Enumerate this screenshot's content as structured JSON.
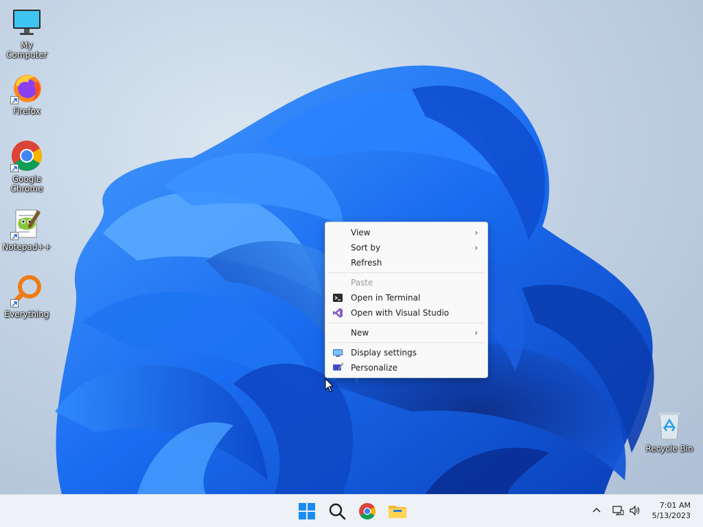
{
  "desktop_icons": [
    {
      "label": "My Computer",
      "icon": "monitor-icon"
    },
    {
      "label": "Firefox",
      "icon": "firefox-icon"
    },
    {
      "label": "Google Chrome",
      "icon": "chrome-icon"
    },
    {
      "label": "Notepad++",
      "icon": "notepad-plus-plus-icon"
    },
    {
      "label": "Everything",
      "icon": "everything-search-icon"
    },
    {
      "label": "Recycle Bin",
      "icon": "recycle-bin-icon"
    }
  ],
  "context_menu": {
    "items": [
      {
        "label": "View",
        "submenu": true
      },
      {
        "label": "Sort by",
        "submenu": true
      },
      {
        "label": "Refresh"
      },
      {
        "label": "Paste",
        "disabled": true
      },
      {
        "label": "Open in Terminal",
        "icon": "terminal-icon"
      },
      {
        "label": "Open with Visual Studio",
        "icon": "visual-studio-icon"
      },
      {
        "label": "New",
        "submenu": true
      },
      {
        "label": "Display settings",
        "icon": "display-settings-icon"
      },
      {
        "label": "Personalize",
        "icon": "personalize-icon"
      }
    ]
  },
  "taskbar": {
    "apps": [
      "start-icon",
      "search-icon",
      "chrome-icon",
      "file-explorer-icon"
    ],
    "tray": [
      "chevron-up-icon",
      "network-icon",
      "volume-icon"
    ],
    "clock": {
      "time": "7:01 AM",
      "date": "5/13/2023"
    }
  },
  "colors": {
    "wallpaper_bloom": "#1a6cf0",
    "taskbar_bg": "#eef1f5",
    "menu_bg": "#f9f9f9"
  }
}
